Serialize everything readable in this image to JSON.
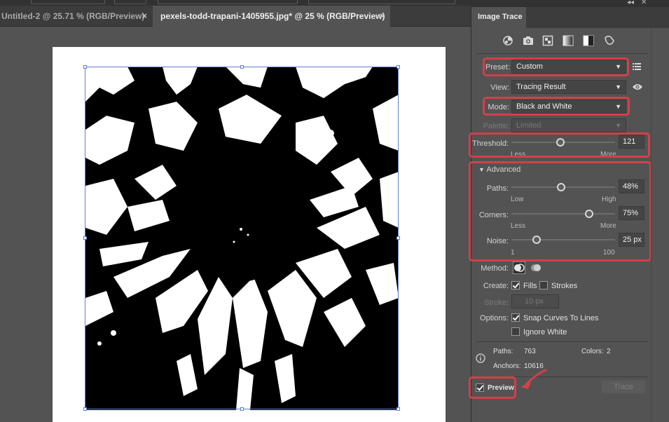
{
  "tabs": [
    {
      "label": "Untitled-2 @ 25.71 % (RGB/Preview)",
      "close": "×"
    },
    {
      "label": "pexels-todd-trapani-1405955.jpg* @ 25 % (RGB/Preview)",
      "close": "×"
    }
  ],
  "panel": {
    "title": "Image Trace",
    "controls": {
      "collapse": "◂◂",
      "close": "✕"
    },
    "icons": [
      "auto-color-icon",
      "high-color-icon",
      "low-color-icon",
      "grayscale-icon",
      "black-white-icon",
      "outline-icon"
    ],
    "preset": {
      "label": "Preset:",
      "value": "Custom"
    },
    "view": {
      "label": "View:",
      "value": "Tracing Result"
    },
    "mode": {
      "label": "Mode:",
      "value": "Black and White"
    },
    "palette": {
      "label": "Palette:",
      "value": "Limited"
    },
    "threshold": {
      "label": "Threshold:",
      "value": "121",
      "level": 121,
      "min": 0,
      "max": 255,
      "low": "Less",
      "high": "More"
    },
    "advanced": {
      "label": "Advanced"
    },
    "paths": {
      "label": "Paths:",
      "value": "48%",
      "level": 0.48,
      "low": "Low",
      "high": "High"
    },
    "corners": {
      "label": "Corners:",
      "value": "75%",
      "level": 0.75,
      "low": "Less",
      "high": "More"
    },
    "noise": {
      "label": "Noise:",
      "value": "25 px",
      "level": 25,
      "min": 1,
      "max": 100,
      "low": "1",
      "high": "100"
    },
    "method": {
      "label": "Method:"
    },
    "create": {
      "label": "Create:",
      "fills": "Fills",
      "strokes": "Strokes",
      "fills_checked": true,
      "strokes_checked": false
    },
    "stroke": {
      "label": "Stroke:",
      "value": "10 px"
    },
    "options": {
      "label": "Options:",
      "snap": "Snap Curves To Lines",
      "snap_checked": true,
      "ignore_white": "Ignore White",
      "ignore_white_checked": false
    },
    "info": {
      "paths_label": "Paths:",
      "paths_value": "763",
      "colors_label": "Colors:",
      "colors_value": "2",
      "anchors_label": "Anchors:",
      "anchors_value": "10616"
    },
    "preview": {
      "label": "Preview",
      "checked": true
    },
    "trace_button": "Trace"
  },
  "colors": {
    "highlight": "#d2404a",
    "selection": "#5b7fd6"
  }
}
